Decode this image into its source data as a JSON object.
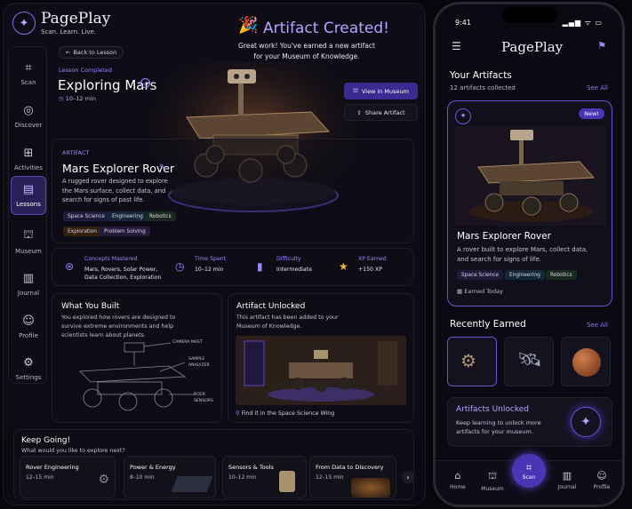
{
  "app": {
    "name": "PagePlay",
    "tagline": "Scan. Learn. Live."
  },
  "sidebar": {
    "items": [
      {
        "label": "Scan",
        "icon": "scan-icon",
        "glyph": "⌗"
      },
      {
        "label": "Discover",
        "icon": "compass-icon",
        "glyph": "◎"
      },
      {
        "label": "Activities",
        "icon": "gamepad-icon",
        "glyph": "⌂"
      },
      {
        "label": "Lessons",
        "icon": "book-icon",
        "glyph": "▤"
      },
      {
        "label": "Museum",
        "icon": "museum-icon",
        "glyph": "⛫"
      },
      {
        "label": "Journal",
        "icon": "journal-icon",
        "glyph": "▥"
      },
      {
        "label": "Profile",
        "icon": "person-icon",
        "glyph": "☺"
      },
      {
        "label": "Settings",
        "icon": "gear-icon",
        "glyph": "⚙"
      }
    ],
    "active": "Lessons"
  },
  "lesson": {
    "back": "Back to Lesson",
    "status": "Lesson Completed",
    "title": "Exploring Mars",
    "duration": "10–12 min"
  },
  "banner": {
    "title": "Artifact Created!",
    "subtitle": "Great work! You've earned a new artifact for your Museum of Knowledge."
  },
  "actions": {
    "view": "View in Museum",
    "share": "Share Artifact"
  },
  "artifact": {
    "label": "ARTIFACT",
    "title": "Mars Explorer Rover",
    "description": "A rugged rover designed to explore the Mars surface, collect data, and search for signs of past life.",
    "tags": [
      "Space Science",
      "Engineering",
      "Robotics",
      "Exploration",
      "Problem Solving"
    ]
  },
  "stats": [
    {
      "label": "Concepts Mastered",
      "value": "Mars, Rovers, Solar Power, Data Collection, Exploration",
      "icon": "concepts-icon"
    },
    {
      "label": "Time Spent",
      "value": "10–12 min",
      "icon": "clock-icon"
    },
    {
      "label": "Difficulty",
      "value": "Intermediate",
      "icon": "bars-icon"
    },
    {
      "label": "XP Earned",
      "value": "+150 XP",
      "icon": "star-icon"
    }
  ],
  "built": {
    "title": "What You Built",
    "description": "You explored how rovers are designed to survive extreme environments and help scientists learn about planets.",
    "callouts": [
      "CAMERA MAST",
      "SAMPLE ANALYZER",
      "ROCK SENSORS"
    ]
  },
  "unlocked": {
    "title": "Artifact Unlocked",
    "description": "This artifact has been added to your Museum of Knowledge.",
    "location": "Find it in the Space Science Wing"
  },
  "keep": {
    "title": "Keep Going!",
    "subtitle": "What would you like to explore next?",
    "cards": [
      {
        "title": "Rover Engineering",
        "meta": "12–15 min"
      },
      {
        "title": "Power & Energy",
        "meta": "8–10 min"
      },
      {
        "title": "Sensors & Tools",
        "meta": "10–12 min"
      },
      {
        "title": "From Data to Discovery",
        "meta": "12–15 min"
      }
    ]
  },
  "phone": {
    "time": "9:41",
    "status": "▂▄▆ ᯤ ▭",
    "artifacts_title": "Your Artifacts",
    "artifacts_count": "12 artifacts collected",
    "see_all": "See All",
    "card": {
      "badge": "New!",
      "title": "Mars Explorer Rover",
      "description": "A rover built to explore Mars, collect data, and search for signs of life.",
      "tags": [
        "Space Science",
        "Engineering",
        "Robotics"
      ],
      "earned": "Earned Today"
    },
    "recent_title": "Recently Earned",
    "recent_see_all": "See All",
    "unlock": {
      "title": "Artifacts Unlocked",
      "description": "Keep learning to unlock more artifacts for your museum."
    },
    "tabs": [
      "Home",
      "Museum",
      "Scan",
      "Journal",
      "Profile"
    ]
  },
  "colors": {
    "accent": "#8b6cf0",
    "accent_dark": "#3b2a8f",
    "background": "#07060c"
  }
}
